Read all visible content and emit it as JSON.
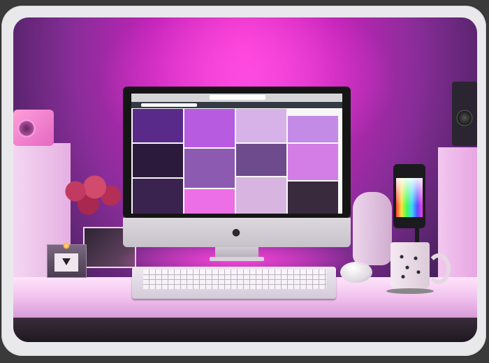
{
  "scene": {
    "description_colors": {
      "wall_glow": "#ff3fd6",
      "desk": "#f2c2ef",
      "accent_magenta": "#e21bc2"
    }
  },
  "monitor": {
    "browser_url": "",
    "brand_logo": "apple-logo",
    "tiles": [
      {
        "id": "t1",
        "color": "#5a2a8a"
      },
      {
        "id": "t2",
        "color": "#b75be0"
      },
      {
        "id": "t3",
        "color": "#d7b2e8"
      },
      {
        "id": "t4",
        "color": "#c38be6"
      },
      {
        "id": "t5",
        "color": "#2c1a3c"
      },
      {
        "id": "t6",
        "color": "#8c5bb1"
      },
      {
        "id": "t7",
        "color": "#6e4b8d"
      },
      {
        "id": "t8",
        "color": "#d27ee6"
      },
      {
        "id": "t9",
        "color": "#3b2350"
      },
      {
        "id": "t10",
        "color": "#ed6fe6"
      },
      {
        "id": "t11",
        "color": "#d7b5e0"
      },
      {
        "id": "t12",
        "color": "#3a2a3e"
      }
    ]
  }
}
